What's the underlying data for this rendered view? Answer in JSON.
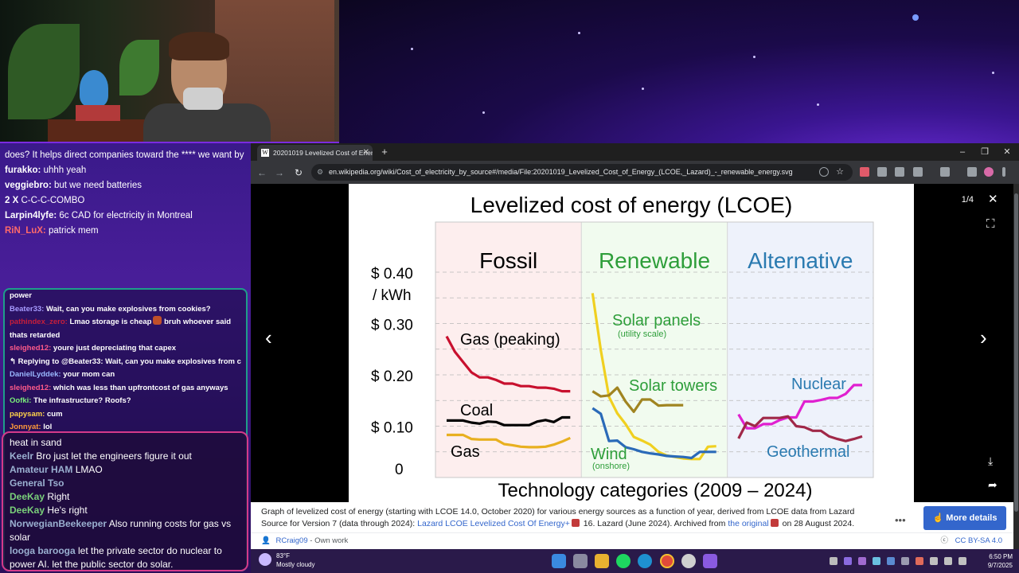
{
  "chat_top": {
    "lines": [
      {
        "user": "",
        "text": "does? It helps direct companies toward the **** we want by incentivizing",
        "emote_color": "#d8a24a"
      },
      {
        "user": "furakko:",
        "text": "uhhh yeah",
        "color": "#ffffff"
      },
      {
        "user": "veggiebro:",
        "text": "but we need batteries",
        "color": "#ffffff"
      },
      {
        "user": "2 X",
        "text": "C-C-C-COMBO",
        "color": "#ffffff"
      },
      {
        "user": "Larpin4lyfe:",
        "text": "6c CAD for electricity in Montreal",
        "color": "#ffffff"
      },
      {
        "user": "RiN_LuX:",
        "text": "patrick mem",
        "color": "#ff6a6a"
      }
    ]
  },
  "chat_mid": {
    "lines": [
      {
        "user": "",
        "text": "power",
        "color": "#ffffff"
      },
      {
        "user": "Beater33:",
        "text": "Wait, can you make explosives from cookies?",
        "color": "#a89cff"
      },
      {
        "user": "pathindex_zero:",
        "text": "Lmao storage is cheap",
        "extra": "bruh whoever said",
        "color": "#c81e3a"
      },
      {
        "user": "",
        "text": "thats retarded",
        "color": "#ffffff"
      },
      {
        "user": "sleighed12:",
        "text": "youre just depreciating that capex",
        "color": "#ff5a8a"
      },
      {
        "user": "",
        "text": "↰ Replying to @Beater33: Wait, can you make explosives from cookies?",
        "color": "#cfcfcf"
      },
      {
        "user": "DanielLyddek:",
        "text": "your mom can",
        "color": "#9ab8ff"
      },
      {
        "user": "sleighed12:",
        "text": "which was less than upfrontcost of gas anyways",
        "color": "#ff5a8a"
      },
      {
        "user": "Oofki:",
        "text": "The infrastructure? Roofs?",
        "color": "#7af07a"
      },
      {
        "user": "papysam:",
        "text": "cum",
        "color": "#ffd24a"
      },
      {
        "user": "Jonnyat:",
        "text": "lol",
        "color": "#ff9a3a"
      }
    ]
  },
  "chat_bottom": {
    "lines": [
      {
        "user": "",
        "text": "heat in sand",
        "color": "#ffffff"
      },
      {
        "user": "Keelr",
        "text": "Bro just let the engineers figure it out",
        "color": "#9ab0d0"
      },
      {
        "user": "Amateur HAM",
        "text": "LMAO",
        "color": "#9ab0d0"
      },
      {
        "user": "General Tso",
        "text": "",
        "color": "#9ab0d0"
      },
      {
        "user": "DeeKay",
        "text": "Right",
        "color": "#7ad07a"
      },
      {
        "user": "DeeKay",
        "text": "He's right",
        "color": "#7ad07a"
      },
      {
        "user": "NorwegianBeekeeper",
        "text": "Also running costs for gas vs solar",
        "color": "#9ab0d0"
      },
      {
        "user": "looga barooga",
        "text": "let the private sector do nuclear to power AI. let the public sector do solar.",
        "color": "#9ab0d0"
      }
    ]
  },
  "browser": {
    "tab_title": "20201019 Levelized Cost of Energy",
    "tab_favicon": "W",
    "tab_close": "✕",
    "new_tab": "+",
    "url": "en.wikipedia.org/wiki/Cost_of_electricity_by_source#/media/File:20201019_Levelized_Cost_of_Energy_(LCOE,_Lazard)_-_renewable_energy.svg",
    "win_min": "–",
    "win_max": "❐",
    "win_close": "✕",
    "back": "←",
    "forward": "→",
    "reload": "↻",
    "site_icon": "⚙"
  },
  "viewer": {
    "counter": "1/4",
    "close": "✕",
    "fullscreen": "⛶",
    "prev": "‹",
    "next": "›",
    "download": "⤓",
    "share": "➦"
  },
  "caption": {
    "line1": "Graph of levelized cost of energy (starting with LCOE 14.0, October 2020) for various energy sources as a function of year, derived from LCOE data from Lazard",
    "line2_a": "Source for Version 7 (data through 2024):",
    "line2_link1": "Lazard LCOE Levelized Cost Of Energy+",
    "line2_b": "16. Lazard (June 2024). Archived from",
    "line2_link2": "the original",
    "line2_c": "on 28 August 2024.",
    "more_details": "More details",
    "more_dots": "•••",
    "author": "RCraig09",
    "author_suffix": "- Own work",
    "license": "CC BY-SA 4.0"
  },
  "chart_data": {
    "type": "line",
    "title": "Levelized cost of energy (LCOE)",
    "xlabel": "Technology categories (2009 – 2024)",
    "ylabel": "$ 0.40 / kWh",
    "y_ticks": [
      "$ 0.10",
      "$ 0.20",
      "$ 0.30",
      "$ 0.40",
      "0"
    ],
    "ylim": [
      0,
      0.5
    ],
    "grid": true,
    "categories": [
      {
        "name": "Fossil",
        "color": "#000000",
        "bg": "#fdeeee"
      },
      {
        "name": "Renewable",
        "color": "#2e9e3a",
        "bg": "#f1fbef"
      },
      {
        "name": "Alternative",
        "color": "#2a7ab0",
        "bg": "#eef2fb"
      }
    ],
    "series": [
      {
        "name": "Gas (peaking)",
        "group": 0,
        "color": "#c8102e",
        "x": [
          2009,
          2010,
          2011,
          2012,
          2013,
          2014,
          2015,
          2016,
          2017,
          2018,
          2019,
          2020,
          2021,
          2022,
          2023,
          2024
        ],
        "values": [
          0.275,
          0.245,
          0.225,
          0.205,
          0.195,
          0.195,
          0.19,
          0.183,
          0.183,
          0.178,
          0.178,
          0.175,
          0.175,
          0.173,
          0.168,
          0.168
        ]
      },
      {
        "name": "Coal",
        "group": 0,
        "color": "#000000",
        "x": [
          2009,
          2010,
          2011,
          2012,
          2013,
          2014,
          2015,
          2016,
          2017,
          2018,
          2019,
          2020,
          2021,
          2022,
          2023,
          2024
        ],
        "values": [
          0.111,
          0.111,
          0.111,
          0.107,
          0.105,
          0.109,
          0.108,
          0.102,
          0.102,
          0.102,
          0.102,
          0.109,
          0.112,
          0.108,
          0.117,
          0.117
        ]
      },
      {
        "name": "Gas",
        "group": 0,
        "color": "#e8b020",
        "x": [
          2009,
          2010,
          2011,
          2012,
          2013,
          2014,
          2015,
          2016,
          2017,
          2018,
          2019,
          2020,
          2021,
          2022,
          2023,
          2024
        ],
        "values": [
          0.083,
          0.083,
          0.083,
          0.075,
          0.074,
          0.074,
          0.074,
          0.065,
          0.063,
          0.06,
          0.059,
          0.059,
          0.06,
          0.064,
          0.07,
          0.077
        ]
      },
      {
        "name": "Solar panels",
        "note": "(utility scale)",
        "group": 1,
        "color": "#f0d020",
        "x": [
          2009,
          2010,
          2011,
          2012,
          2013,
          2014,
          2015,
          2016,
          2017,
          2018,
          2019,
          2020,
          2021,
          2022,
          2023,
          2024
        ],
        "values": [
          0.359,
          0.248,
          0.157,
          0.125,
          0.104,
          0.079,
          0.072,
          0.064,
          0.05,
          0.043,
          0.04,
          0.037,
          0.036,
          0.036,
          0.06,
          0.061
        ]
      },
      {
        "name": "Solar towers",
        "group": 1,
        "color": "#a08420",
        "x": [
          2009,
          2010,
          2011,
          2012,
          2013,
          2014,
          2015,
          2016,
          2017,
          2018,
          2019,
          2020
        ],
        "values": [
          0.168,
          0.158,
          0.16,
          0.175,
          0.148,
          0.128,
          0.152,
          0.152,
          0.14,
          0.141,
          0.141,
          0.141
        ]
      },
      {
        "name": "Wind",
        "note": "(onshore)",
        "group": 1,
        "color": "#2a6ab8",
        "x": [
          2009,
          2010,
          2011,
          2012,
          2013,
          2014,
          2015,
          2016,
          2017,
          2018,
          2019,
          2020,
          2021,
          2022,
          2023,
          2024
        ],
        "values": [
          0.135,
          0.124,
          0.071,
          0.072,
          0.059,
          0.055,
          0.05,
          0.047,
          0.045,
          0.042,
          0.041,
          0.04,
          0.038,
          0.05,
          0.05,
          0.05
        ]
      },
      {
        "name": "Nuclear",
        "group": 2,
        "color": "#e020d0",
        "x": [
          2009,
          2010,
          2011,
          2012,
          2013,
          2014,
          2015,
          2016,
          2017,
          2018,
          2019,
          2020,
          2021,
          2022,
          2023,
          2024
        ],
        "values": [
          0.123,
          0.096,
          0.096,
          0.104,
          0.104,
          0.112,
          0.117,
          0.117,
          0.148,
          0.148,
          0.151,
          0.155,
          0.155,
          0.163,
          0.18,
          0.18
        ]
      },
      {
        "name": "Geothermal",
        "group": 2,
        "color": "#a02848",
        "x": [
          2009,
          2010,
          2011,
          2012,
          2013,
          2014,
          2015,
          2016,
          2017,
          2018,
          2019,
          2020,
          2021,
          2022,
          2023,
          2024
        ],
        "values": [
          0.076,
          0.107,
          0.1,
          0.116,
          0.116,
          0.116,
          0.119,
          0.1,
          0.098,
          0.091,
          0.091,
          0.08,
          0.075,
          0.071,
          0.075,
          0.08
        ]
      }
    ]
  },
  "taskbar": {
    "temperature": "83°F",
    "weather": "Mostly cloudy",
    "time": "6:50 PM",
    "date": "9/7/2025"
  }
}
